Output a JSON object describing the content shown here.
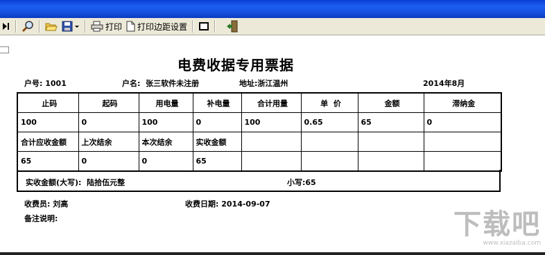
{
  "toolbar": {
    "print_label": "打印",
    "margin_label": "打印边距设置"
  },
  "receipt": {
    "title": "电费收据专用票据",
    "account_label": "户号:",
    "account_value": "1001",
    "name_label": "户名:",
    "name_value": "张三软件未注册",
    "address_label": "地址:",
    "address_value": "浙江温州",
    "period": "2014年8月",
    "headers1": [
      "止码",
      "起码",
      "用电量",
      "补电量",
      "合计用量",
      "单  价",
      "金额",
      "滞纳金"
    ],
    "values1": [
      "100",
      "0",
      "100",
      "0",
      "100",
      "0.65",
      "65",
      "0"
    ],
    "headers2": [
      "合计应收金额",
      "上次结余",
      "本次结余",
      "实收金额"
    ],
    "values2": [
      "65",
      "0",
      "0",
      "65"
    ],
    "amount_words_label": "实收金额(大写):",
    "amount_words_value": "陆拾伍元整",
    "amount_small_label": "小写:",
    "amount_small_value": "65",
    "cashier_label": "收费员:",
    "cashier_value": "刘高",
    "date_label": "收费日期:",
    "date_value": "2014-09-07",
    "remark_label": "备注说明:"
  },
  "watermark": {
    "text": "下载吧",
    "url": "www.xiazaiba.com"
  }
}
